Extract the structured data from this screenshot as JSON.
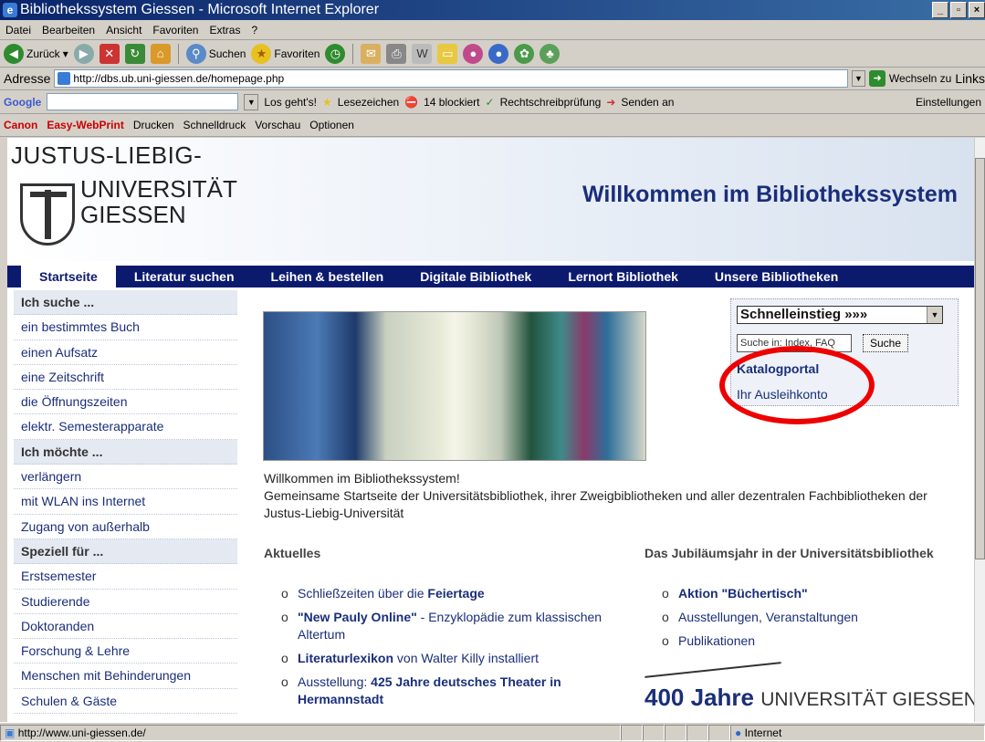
{
  "window": {
    "title": "Bibliothekssystem Giessen - Microsoft Internet Explorer"
  },
  "menu": [
    "Datei",
    "Bearbeiten",
    "Ansicht",
    "Favoriten",
    "Extras",
    "?"
  ],
  "toolbar": {
    "back": "Zurück",
    "search": "Suchen",
    "favorites": "Favoriten"
  },
  "address": {
    "label": "Adresse",
    "url": "http://dbs.ub.uni-giessen.de/homepage.php",
    "go": "Wechseln zu",
    "links": "Links"
  },
  "google": {
    "brand": "Google",
    "go": "Los geht's!",
    "bookmarks": "Lesezeichen",
    "blocked": "14 blockiert",
    "spell": "Rechtschreibprüfung",
    "send": "Senden an",
    "settings": "Einstellungen"
  },
  "canon": {
    "brand": "Canon",
    "product": "Easy-WebPrint",
    "print": "Drucken",
    "quick": "Schnelldruck",
    "preview": "Vorschau",
    "options": "Optionen"
  },
  "page": {
    "logo_top": "JUSTUS-LIEBIG-",
    "logo_line1": "UNIVERSITÄT",
    "logo_line2": "GIESSEN",
    "welcome": "Willkommen im Bibliothekssystem",
    "nav": [
      "Startseite",
      "Literatur suchen",
      "Leihen & bestellen",
      "Digitale Bibliothek",
      "Lernort Bibliothek",
      "Unsere Bibliotheken"
    ],
    "sidebar": [
      {
        "label": "Ich suche ...",
        "header": true
      },
      {
        "label": "ein bestimmtes Buch"
      },
      {
        "label": "einen Aufsatz"
      },
      {
        "label": "eine Zeitschrift"
      },
      {
        "label": "die Öffnungszeiten"
      },
      {
        "label": "elektr. Semesterapparate"
      },
      {
        "label": "Ich möchte ...",
        "header": true
      },
      {
        "label": "verlängern"
      },
      {
        "label": "mit WLAN ins Internet"
      },
      {
        "label": "Zugang von außerhalb"
      },
      {
        "label": "Speziell für ...",
        "header": true
      },
      {
        "label": "Erstsemester"
      },
      {
        "label": "Studierende"
      },
      {
        "label": "Doktoranden"
      },
      {
        "label": "Forschung & Lehre"
      },
      {
        "label": "Menschen mit Behinderungen"
      },
      {
        "label": "Schulen & Gäste"
      }
    ],
    "quick": {
      "select": "Schnelleinstieg »»»",
      "search_placeholder": "Suche in: Index, FAQ",
      "search_button": "Suche",
      "link1": "Katalogportal",
      "link2": "Ihr Ausleihkonto"
    },
    "intro_line1": "Willkommen im Bibliothekssystem!",
    "intro_line2": "Gemeinsame Startseite der Universitätsbibliothek, ihrer Zweigbibliotheken und aller dezentralen Fachbibliotheken der Justus-Liebig-Universität",
    "news_title": "Aktuelles",
    "news": [
      {
        "pre": "Schließzeiten über die ",
        "bold": "Feiertage",
        "post": ""
      },
      {
        "pre": "",
        "bold": "\"New Pauly Online\"",
        "post": " - Enzyklopädie zum klassischen Altertum"
      },
      {
        "pre": "",
        "bold": "Literaturlexikon",
        "post": " von Walter Killy installiert"
      },
      {
        "pre": "Ausstellung: ",
        "bold": "425 Jahre deutsches Theater in Hermannstadt",
        "post": ""
      }
    ],
    "jub_title": "Das Jubiläumsjahr in der Universitätsbibliothek",
    "jub": [
      {
        "pre": "",
        "bold": "Aktion \"Büchertisch\"",
        "post": ""
      },
      {
        "pre": "Ausstellungen, Veranstaltungen",
        "bold": "",
        "post": ""
      },
      {
        "pre": "Publikationen",
        "bold": "",
        "post": ""
      }
    ],
    "jub_logo_big": "400 Jahre",
    "jub_logo_small": "UNIVERSITÄT GIESSEN"
  },
  "status": {
    "url": "http://www.uni-giessen.de/",
    "zone": "Internet"
  },
  "colors": {
    "nav_bg": "#0c1a6e",
    "link": "#1a2e7a",
    "highlight_circle": "#e00000"
  }
}
